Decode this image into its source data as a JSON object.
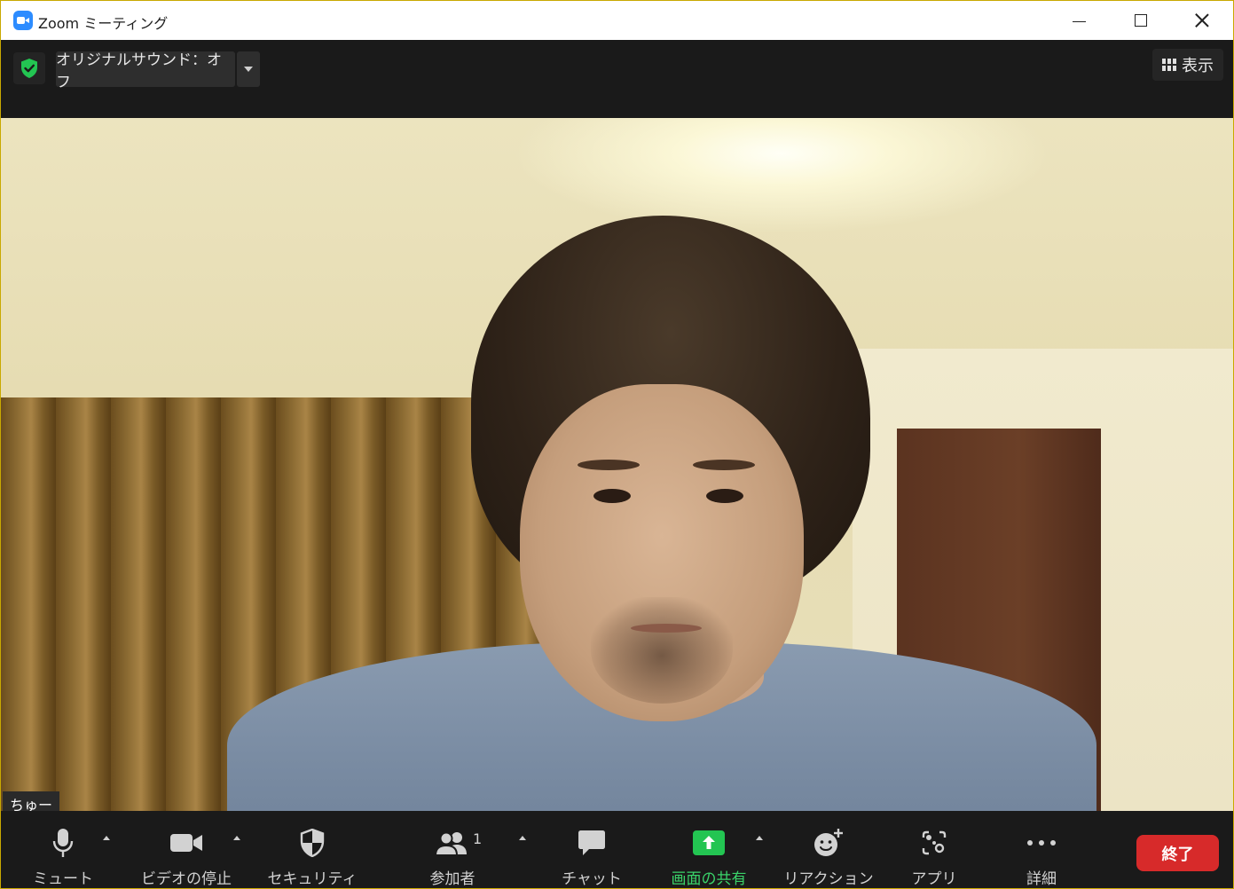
{
  "window": {
    "title": "Zoom ミーティング"
  },
  "topbar": {
    "sound_label": "オリジナルサウンド：オフ",
    "view_label": "表示"
  },
  "video": {
    "participant_name": "ちゅー"
  },
  "toolbar": {
    "mute": "ミュート",
    "stop_video": "ビデオの停止",
    "security": "セキュリティ",
    "participants": "参加者",
    "participants_count": "1",
    "chat": "チャット",
    "share": "画面の共有",
    "reactions": "リアクション",
    "apps": "アプリ",
    "more": "詳細",
    "end": "終了"
  },
  "colors": {
    "zoom_blue": "#2d8cff",
    "share_green": "#3ad36a",
    "end_red": "#d72a2a",
    "security_green": "#23c552"
  }
}
